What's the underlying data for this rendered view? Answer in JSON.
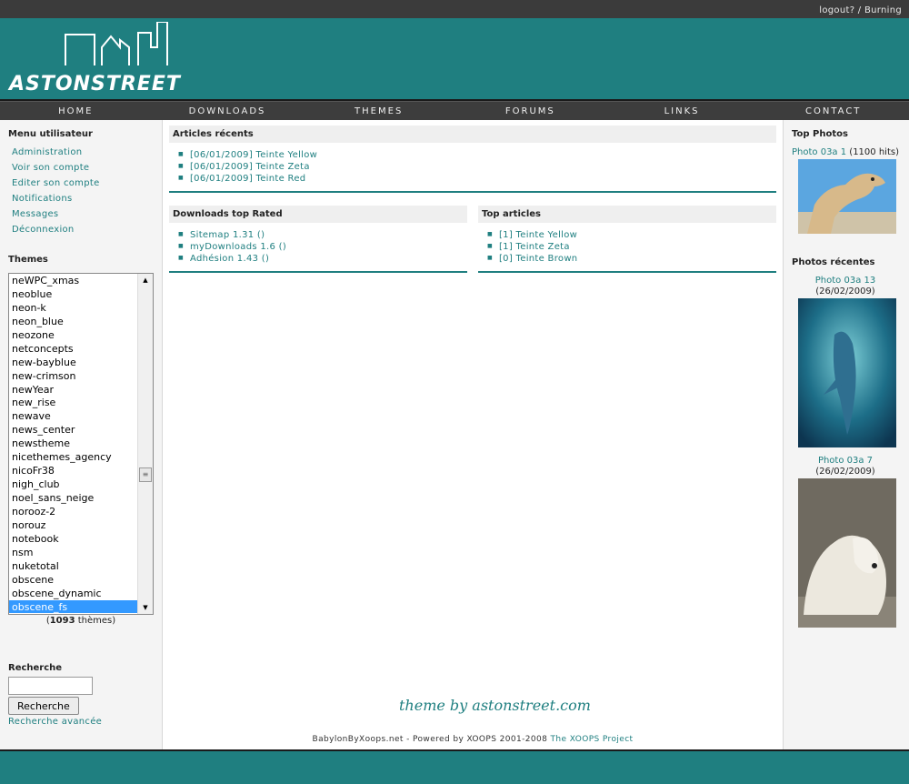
{
  "topbar": {
    "logout": "logout?",
    "sep": "/",
    "user": "Burning"
  },
  "brand": {
    "name": "ASTONSTREET"
  },
  "nav": [
    "HOME",
    "DOWNLOADS",
    "THEMES",
    "FORUMS",
    "LINKS",
    "CONTACT"
  ],
  "left": {
    "user_menu_title": "Menu utilisateur",
    "user_menu": [
      "Administration",
      "Voir son compte",
      "Editer son compte",
      "Notifications",
      "Messages",
      "Déconnexion"
    ],
    "themes_title": "Themes",
    "themes": [
      "neWPC_xmas",
      "neoblue",
      "neon-k",
      "neon_blue",
      "neozone",
      "netconcepts",
      "new-bayblue",
      "new-crimson",
      "newYear",
      "new_rise",
      "newave",
      "news_center",
      "newstheme",
      "nicethemes_agency",
      "nicoFr38",
      "nigh_club",
      "noel_sans_neige",
      "norooz-2",
      "norouz",
      "notebook",
      "nsm",
      "nuketotal",
      "obscene",
      "obscene_dynamic",
      "obscene_fs"
    ],
    "themes_selected": "obscene_fs",
    "themes_count_num": "1093",
    "themes_count_label": "thèmes",
    "search_title": "Recherche",
    "search_button": "Recherche",
    "search_advanced": "Recherche avancée"
  },
  "center": {
    "recent": {
      "title": "Articles récents",
      "items": [
        "[06/01/2009] Teinte Yellow",
        "[06/01/2009] Teinte Zeta",
        "[06/01/2009] Teinte Red"
      ]
    },
    "downloads": {
      "title": "Downloads top Rated",
      "items": [
        "Sitemap 1.31 ()",
        "myDownloads 1.6 ()",
        "Adhésion 1.43 ()"
      ]
    },
    "top_articles": {
      "title": "Top articles",
      "items": [
        "[1] Teinte Yellow",
        "[1] Teinte Zeta",
        "[0] Teinte Brown"
      ]
    },
    "signature": "theme by astonstreet.com",
    "footer_text": "BabylonByXoops.net - Powered by XOOPS 2001-2008",
    "footer_link": "The XOOPS Project"
  },
  "right": {
    "top_title": "Top Photos",
    "top_photo": {
      "name": "Photo 03a 1",
      "extra": "(1100 hits)"
    },
    "recent_title": "Photos récentes",
    "recent_photos": [
      {
        "name": "Photo 03a 13",
        "extra": "(26/02/2009)"
      },
      {
        "name": "Photo 03a 7",
        "extra": "(26/02/2009)"
      }
    ]
  },
  "colors": {
    "accent": "#1f7f80",
    "nav_bg": "#3d3d3d",
    "selected": "#3399ff"
  }
}
